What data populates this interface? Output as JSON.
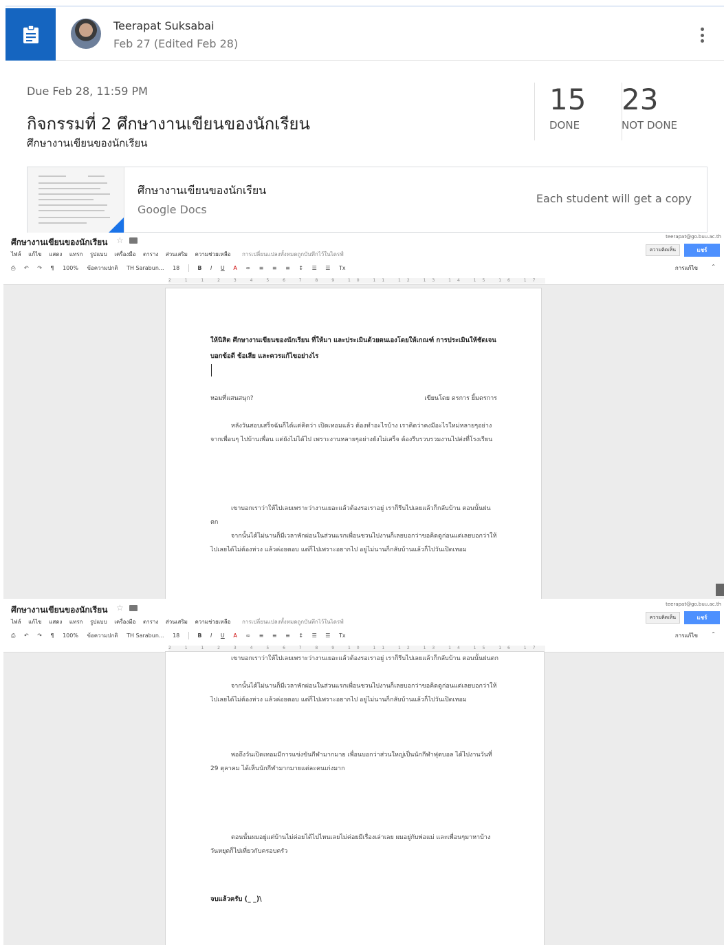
{
  "post": {
    "author": "Teerapat Suksabai",
    "date": "Feb 27 (Edited Feb 28)",
    "icons": {
      "assignment": "assignment-icon",
      "more": "more-vert-icon"
    }
  },
  "assignment": {
    "due": "Due Feb 28, 11:59 PM",
    "title": "กิจกรรมที่ 2 ศึกษางานเขียนของนักเรียน",
    "subtitle": "ศึกษางานเขียนของนักเรียน"
  },
  "stats": {
    "done_count": "15",
    "done_label": "DONE",
    "not_done_count": "23",
    "not_done_label": "NOT DONE"
  },
  "attachment": {
    "name": "ศึกษางานเขียนของนักเรียน",
    "type": "Google Docs",
    "note": "Each student will get a copy"
  },
  "doc": {
    "title": "ศึกษางานเขียนของนักเรียน",
    "email": "teerapat@go.buu.ac.th",
    "menu": [
      "ไฟล์",
      "แก้ไข",
      "แสดง",
      "แทรก",
      "รูปแบบ",
      "เครื่องมือ",
      "ตาราง",
      "ส่วนเสริม",
      "ความช่วยเหลือ"
    ],
    "saved_status": "การเปลี่ยนแปลงทั้งหมดถูกบันทึกไว้ในไดรฟ์",
    "comments_button": "ความคิดเห็น",
    "share_button": "แชร์",
    "zoom": "100%",
    "style": "ข้อความปกติ",
    "font": "TH Sarabun...",
    "font_size": "18",
    "edit_mode": "การแก้ไข",
    "instruction": "ให้นิสิต ศึกษางานเขียนของนักเรียน ที่ให้มา และประเมินด้วยตนเองโดยให้เกณฑ์ การประเมินให้ชัดเจนบอกข้อดี ข้อเสีย และควรแก้ไขอย่างไร",
    "essay_title": "หอมที่แสนสนุก?",
    "essay_author": "เขียนโดย ดรการ ยิ้มดรการ",
    "para1": "หลังวันสอบเสร็จฉันก็ได้แต่คิดว่า เปิดเทอมแล้ว ต้องทำอะไรบ้าง เราคิดว่าคงมีอะไรใหม่หลายๆอย่างจากเพื่อนๆ ไปบ้านเพื่อน แต่ยังไม่ได้ไป เพราะงานหลายๆอย่างยังไม่เสร็จ ต้องรีบรวบรวมงานไปส่งที่โรงเรียน",
    "para2": "เขาบอกเราว่าให้ไปเลยเพราะว่างานเยอะแล้วต้องรอเราอยู่ เราก็รีบไปเลยแล้วก็กลับบ้าน ตอนนั้นฝนตก",
    "para3": "จากนั้นได้ไม่นานก็มีเวลาพักผ่อนในส่วนแรกเพื่อนชวนไปงานก็เลยบอกว่าขอคิดดูก่อนแต่เลยบอกว่าให้ไปเลยได้ไม่ต้องห่วง แล้วค่อยตอบ แต่ก็ไปเพราะอยากไป อยู่ไม่นานก็กลับบ้านแล้วก็ไปวันเปิดเทอม",
    "para4": "พอถึงวันเปิดเทอมมีการแข่งขันกีฬามากมาย เพื่อนบอกว่าส่วนใหญ่เป็นนักกีฬาฟุตบอล ได้ไปงานวันที่ 29 ตุลาคม ได้เห็นนักกีฬามากมายแต่ละคนเก่งมาก",
    "para5": "ตอนนั้นผมอยู่แต่บ้านไม่ค่อยได้ไปไหนเลยไม่ค่อยมีเรื่องเล่าเลย ผมอยู่กับพ่อแม่ และเพื่อนๆมาหาบ้าง วันหยุดก็ไปเที่ยวกับครอบครัว",
    "signoff": "จบแล้วครับ (_ _)\\"
  }
}
